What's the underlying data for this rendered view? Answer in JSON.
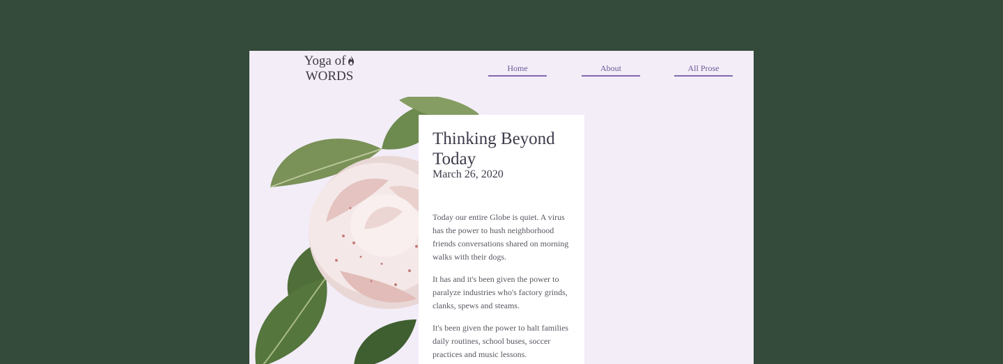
{
  "logo": {
    "line1": "Yoga of",
    "line2": "WORDS",
    "icon": "flame-icon"
  },
  "nav": {
    "items": [
      {
        "label": "Home"
      },
      {
        "label": "About"
      },
      {
        "label": "All Prose"
      }
    ],
    "accent_color": "#7e69ad"
  },
  "post": {
    "title": "Thinking Beyond Today",
    "date": "March 26, 2020",
    "paragraphs": [
      "Today our entire Globe is quiet. A virus has the power to hush neighborhood friends conversations shared on morning walks with their dogs.",
      "It has and it's been given the power to paralyze industries who's factory grinds, clanks, spews and steams.",
      "It's been given the power to halt families daily routines, school buses, soccer practices and music lessons."
    ]
  },
  "colors": {
    "background": "#344a3a",
    "page": "#f3edf8",
    "card": "#ffffff"
  }
}
